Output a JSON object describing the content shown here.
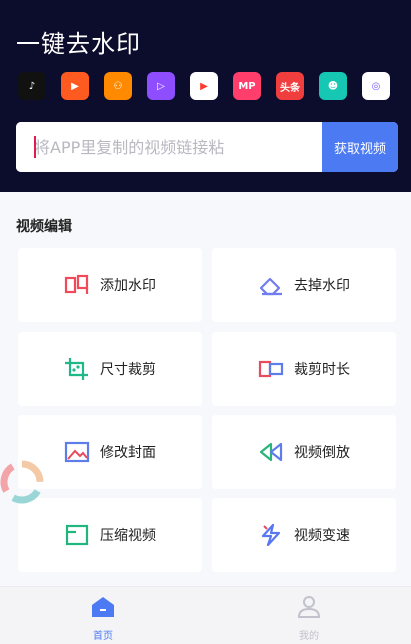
{
  "header": {
    "title": "一键去水印"
  },
  "apps": [
    {
      "icon": "douyin-icon",
      "bg": "#111111",
      "glyph": "♪",
      "fg": "#ffffff"
    },
    {
      "icon": "kuaishou-icon",
      "bg": "#ff5a1f",
      "glyph": "▶",
      "fg": "#ffffff"
    },
    {
      "icon": "kuaishou-alt-icon",
      "bg": "#ff8a00",
      "glyph": "⚇",
      "fg": "#ffffff"
    },
    {
      "icon": "weishi-icon",
      "bg": "#8e4dff",
      "glyph": "▷",
      "fg": "#ffffff"
    },
    {
      "icon": "play-icon",
      "bg": "#ffffff",
      "glyph": "▶",
      "fg": "#ff3b2f"
    },
    {
      "icon": "mp-icon",
      "bg": "#ff3e6b",
      "glyph": "MP",
      "fg": "#ffffff"
    },
    {
      "icon": "toutiao-icon",
      "bg": "#f03e3e",
      "glyph": "头条",
      "fg": "#ffffff"
    },
    {
      "icon": "frog-icon",
      "bg": "#16c7b3",
      "glyph": "☻",
      "fg": "#ffffff"
    },
    {
      "icon": "chat-icon",
      "bg": "#ffffff",
      "glyph": "◎",
      "fg": "#6e58ff"
    }
  ],
  "search": {
    "placeholder": "将APP里复制的视频链接粘",
    "button": "获取视频"
  },
  "section": {
    "title": "视频编辑"
  },
  "tools": [
    {
      "label": "添加水印",
      "icon": "add-watermark-icon",
      "color": "#f24a5b"
    },
    {
      "label": "去掉水印",
      "icon": "remove-watermark-icon",
      "color": "#6f7dee"
    },
    {
      "label": "尺寸裁剪",
      "icon": "crop-icon",
      "color": "#1fb889"
    },
    {
      "label": "裁剪时长",
      "icon": "trim-duration-icon",
      "color": "#e84a5e"
    },
    {
      "label": "修改封面",
      "icon": "cover-icon",
      "color": "#5f7de8"
    },
    {
      "label": "视频倒放",
      "icon": "rewind-icon",
      "color": "#2bb37c"
    },
    {
      "label": "压缩视频",
      "icon": "compress-icon",
      "color": "#21b67e"
    },
    {
      "label": "视频变速",
      "icon": "speed-icon",
      "color": "#5a76f0"
    }
  ],
  "tabs": [
    {
      "label": "首页",
      "icon": "home-icon",
      "color": "#4c7af3"
    },
    {
      "label": "我的",
      "icon": "profile-icon",
      "color": "#c2c2cc"
    }
  ],
  "colors": {
    "header_bg": "#0c0c2c",
    "accent": "#4c7af3"
  }
}
